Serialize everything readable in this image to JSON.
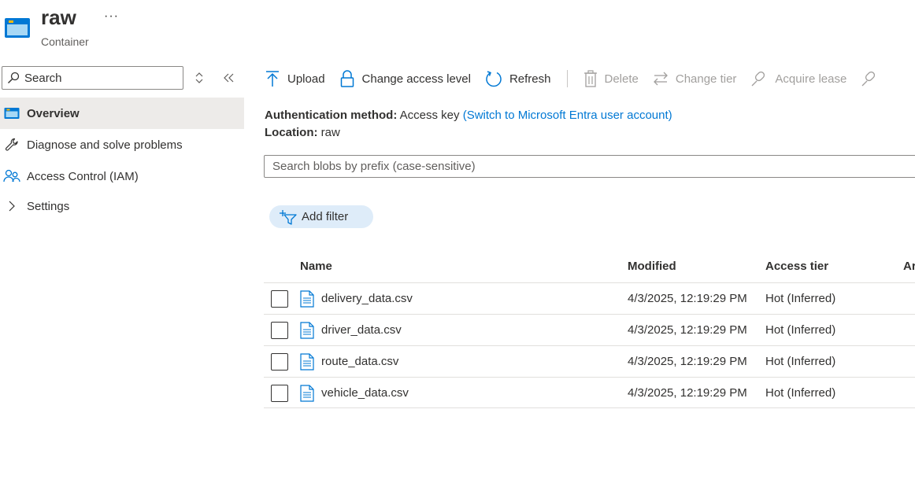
{
  "header": {
    "title": "raw",
    "more": "···",
    "subtitle": "Container"
  },
  "nav": {
    "search_placeholder": "Search",
    "items": [
      {
        "label": "Overview",
        "icon": "container-icon",
        "selected": true
      },
      {
        "label": "Diagnose and solve problems",
        "icon": "wrench-icon"
      },
      {
        "label": "Access Control (IAM)",
        "icon": "people-icon"
      },
      {
        "label": "Settings",
        "icon": "chevron-right-icon"
      }
    ]
  },
  "toolbar": {
    "upload": "Upload",
    "change_access": "Change access level",
    "refresh": "Refresh",
    "delete": "Delete",
    "change_tier": "Change tier",
    "acquire_lease": "Acquire lease"
  },
  "info": {
    "auth_label": "Authentication method:",
    "auth_value": "Access key",
    "auth_link": "(Switch to Microsoft Entra user account)",
    "location_label": "Location:",
    "location_value": "raw"
  },
  "blob_search": {
    "placeholder": "Search blobs by prefix (case-sensitive)"
  },
  "filter": {
    "label": "Add filter"
  },
  "table": {
    "columns": [
      "Name",
      "Modified",
      "Access tier",
      "Ar"
    ],
    "rows": [
      {
        "name": "delivery_data.csv",
        "modified": "4/3/2025, 12:19:29 PM",
        "tier": "Hot (Inferred)"
      },
      {
        "name": "driver_data.csv",
        "modified": "4/3/2025, 12:19:29 PM",
        "tier": "Hot (Inferred)"
      },
      {
        "name": "route_data.csv",
        "modified": "4/3/2025, 12:19:29 PM",
        "tier": "Hot (Inferred)"
      },
      {
        "name": "vehicle_data.csv",
        "modified": "4/3/2025, 12:19:29 PM",
        "tier": "Hot (Inferred)"
      }
    ]
  },
  "colors": {
    "accent": "#0078d4",
    "selected_bg": "#edebe9",
    "filter_bg": "#deecf9",
    "disabled": "#a19f9d"
  }
}
